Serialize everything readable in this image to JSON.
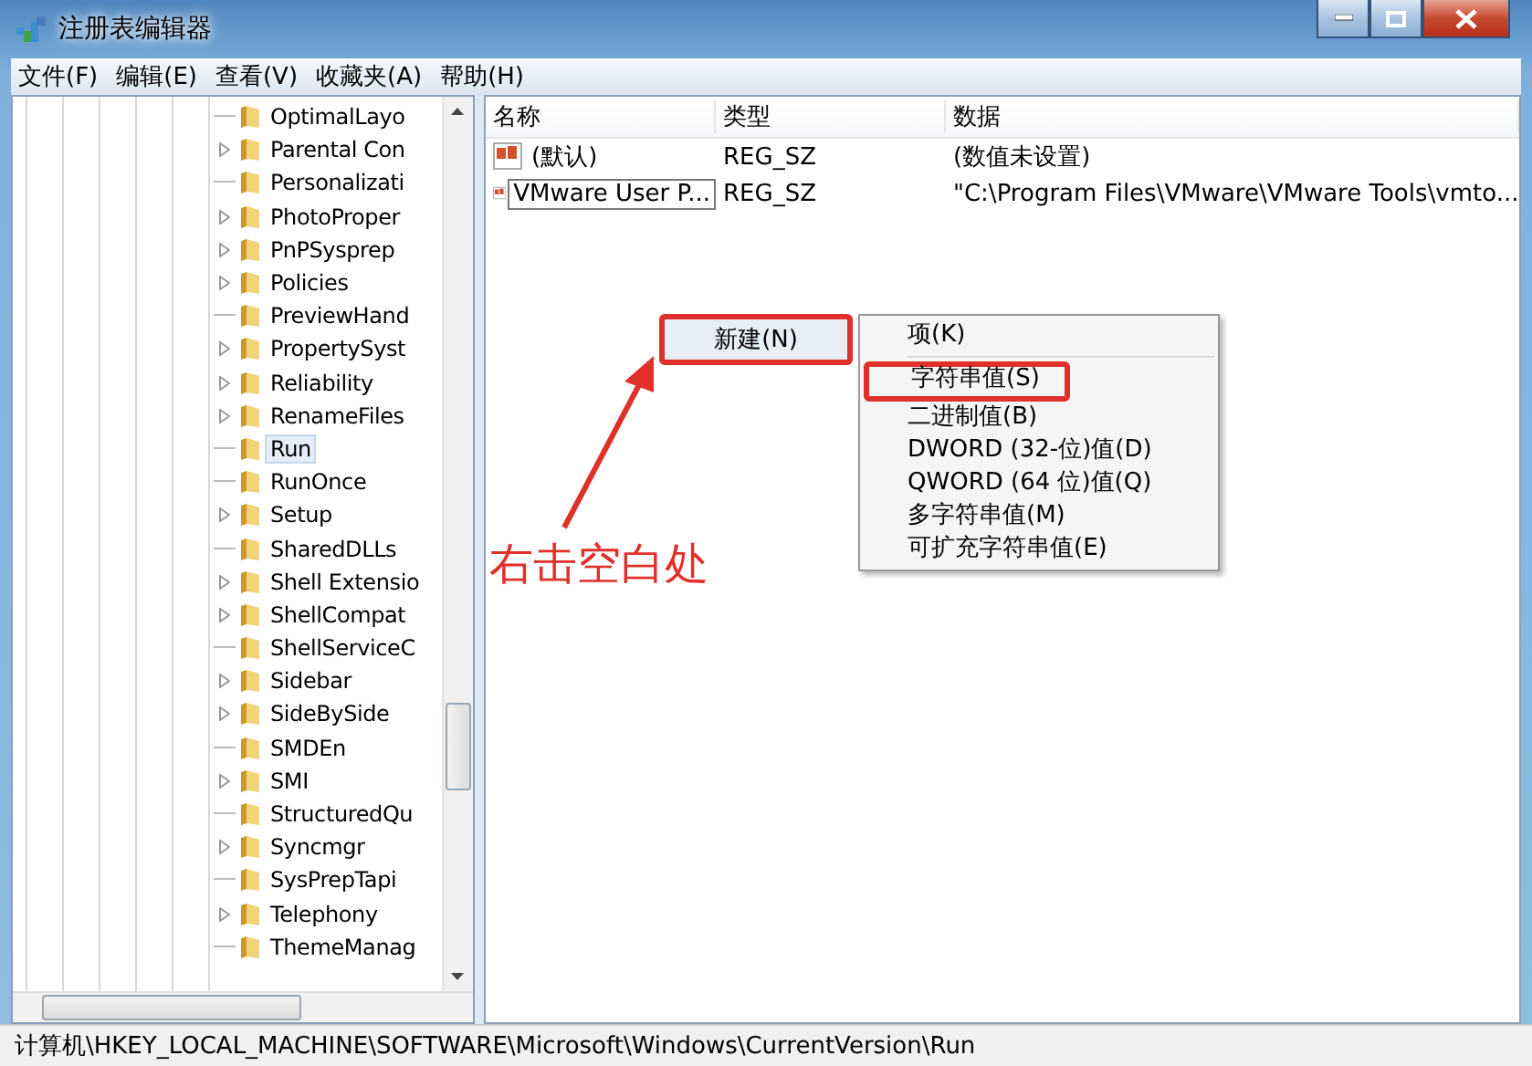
{
  "window": {
    "title": "注册表编辑器"
  },
  "menu_bar": [
    "文件(F)",
    "编辑(E)",
    "查看(V)",
    "收藏夹(A)",
    "帮助(H)"
  ],
  "tree": {
    "items": [
      {
        "label": "OptimalLayo",
        "expandable": false,
        "selected": false
      },
      {
        "label": "Parental Con",
        "expandable": true,
        "selected": false
      },
      {
        "label": "Personalizati",
        "expandable": false,
        "selected": false
      },
      {
        "label": "PhotoProper",
        "expandable": true,
        "selected": false
      },
      {
        "label": "PnPSysprep",
        "expandable": true,
        "selected": false
      },
      {
        "label": "Policies",
        "expandable": true,
        "selected": false
      },
      {
        "label": "PreviewHand",
        "expandable": false,
        "selected": false
      },
      {
        "label": "PropertySyst",
        "expandable": true,
        "selected": false
      },
      {
        "label": "Reliability",
        "expandable": true,
        "selected": false
      },
      {
        "label": "RenameFiles",
        "expandable": true,
        "selected": false
      },
      {
        "label": "Run",
        "expandable": false,
        "selected": true
      },
      {
        "label": "RunOnce",
        "expandable": false,
        "selected": false
      },
      {
        "label": "Setup",
        "expandable": true,
        "selected": false
      },
      {
        "label": "SharedDLLs",
        "expandable": false,
        "selected": false
      },
      {
        "label": "Shell Extensio",
        "expandable": true,
        "selected": false
      },
      {
        "label": "ShellCompat",
        "expandable": true,
        "selected": false
      },
      {
        "label": "ShellServiceC",
        "expandable": false,
        "selected": false
      },
      {
        "label": "Sidebar",
        "expandable": true,
        "selected": false
      },
      {
        "label": "SideBySide",
        "expandable": true,
        "selected": false
      },
      {
        "label": "SMDEn",
        "expandable": false,
        "selected": false
      },
      {
        "label": "SMI",
        "expandable": true,
        "selected": false
      },
      {
        "label": "StructuredQu",
        "expandable": false,
        "selected": false
      },
      {
        "label": "Syncmgr",
        "expandable": true,
        "selected": false
      },
      {
        "label": "SysPrepTapi",
        "expandable": false,
        "selected": false
      },
      {
        "label": "Telephony",
        "expandable": true,
        "selected": false
      },
      {
        "label": "ThemeManag",
        "expandable": false,
        "selected": false
      }
    ]
  },
  "list": {
    "columns": [
      "名称",
      "类型",
      "数据"
    ],
    "rows": [
      {
        "name": "(默认)",
        "type": "REG_SZ",
        "data": "(数值未设置)",
        "editing": false
      },
      {
        "name": "VMware User P...",
        "type": "REG_SZ",
        "data": "\"C:\\Program Files\\VMware\\VMware Tools\\vmto...",
        "editing": true
      }
    ]
  },
  "context_menu": {
    "item": "新建(N)",
    "highlighted": true
  },
  "submenu": {
    "items": [
      {
        "label": "项(K)",
        "highlighted": false,
        "separator_after": true
      },
      {
        "label": "字符串值(S)",
        "highlighted": true,
        "separator_after": false
      },
      {
        "label": "二进制值(B)",
        "highlighted": false,
        "separator_after": false
      },
      {
        "label": "DWORD (32-位)值(D)",
        "highlighted": false,
        "separator_after": false
      },
      {
        "label": "QWORD (64 位)值(Q)",
        "highlighted": false,
        "separator_after": false
      },
      {
        "label": "多字符串值(M)",
        "highlighted": false,
        "separator_after": false
      },
      {
        "label": "可扩充字符串值(E)",
        "highlighted": false,
        "separator_after": false
      }
    ]
  },
  "annotation": {
    "text": "右击空白处"
  },
  "status_bar": "计算机\\HKEY_LOCAL_MACHINE\\SOFTWARE\\Microsoft\\Windows\\CurrentVersion\\Run"
}
